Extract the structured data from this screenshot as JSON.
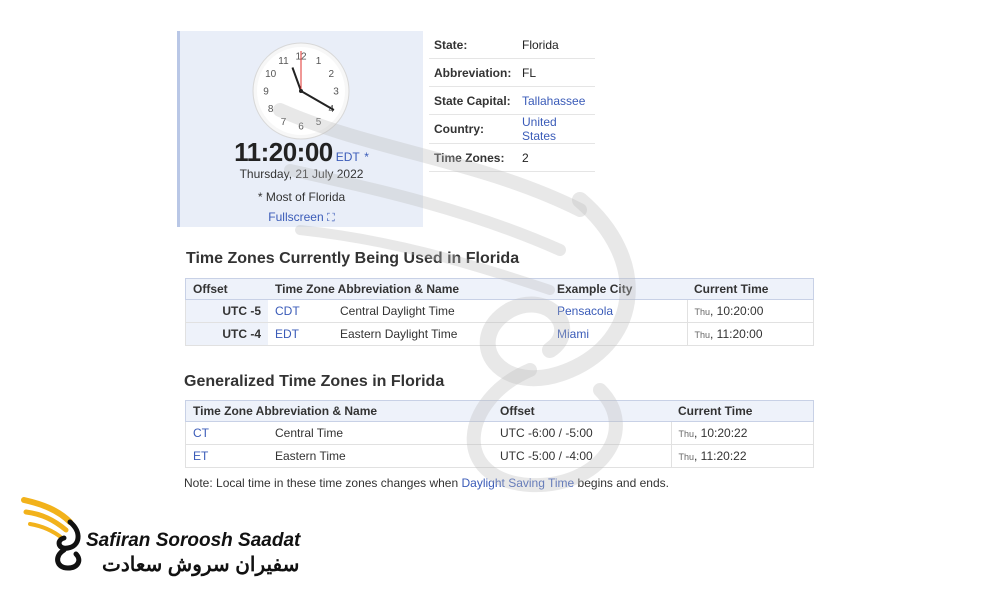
{
  "clock": {
    "numbers": [
      "12",
      "1",
      "2",
      "3",
      "4",
      "5",
      "6",
      "7",
      "8",
      "9",
      "10",
      "11"
    ],
    "time_hm": "11:20:00",
    "tz_abbr": "EDT",
    "star": "*",
    "date": "Thursday, 21 July 2022",
    "note": "* Most of Florida",
    "fullscreen_label": "Fullscreen",
    "fullscreen_icon": "expand-icon"
  },
  "info": {
    "rows": [
      {
        "key": "State:",
        "value": "Florida"
      },
      {
        "key": "Abbreviation:",
        "value": "FL"
      },
      {
        "key": "State Capital:",
        "value": "Tallahassee"
      },
      {
        "key": "Country:",
        "value": "United States"
      },
      {
        "key": "Time Zones:",
        "value": "2"
      }
    ]
  },
  "current_section": {
    "title": "Time Zones Currently Being Used in Florida",
    "headers": [
      "Offset",
      "Time Zone Abbreviation & Name",
      "Example City",
      "Current Time"
    ],
    "rows": [
      {
        "offset": "UTC -5",
        "abbr": "CDT",
        "name": "Central Daylight Time",
        "city": "Pensacola",
        "day": "Thu",
        "time": ", 10:20:00"
      },
      {
        "offset": "UTC -4",
        "abbr": "EDT",
        "name": "Eastern Daylight Time",
        "city": "Miami",
        "day": "Thu",
        "time": ", 11:20:00"
      }
    ]
  },
  "general_section": {
    "title": "Generalized Time Zones in Florida",
    "headers": [
      "Time Zone Abbreviation & Name",
      "Offset",
      "Current Time"
    ],
    "rows": [
      {
        "abbr": "CT",
        "name": "Central Time",
        "offset": "UTC -6:00 / -5:00",
        "day": "Thu",
        "time": ", 10:20:22"
      },
      {
        "abbr": "ET",
        "name": "Eastern Time",
        "offset": "UTC -5:00 / -4:00",
        "day": "Thu",
        "time": ", 11:20:22"
      }
    ]
  },
  "footnote": {
    "before": "Note: Local time in these time zones changes when ",
    "link": "Daylight Saving Time",
    "after": " begins and ends."
  },
  "logo": {
    "name_en": "Safiran Soroosh Saadat",
    "name_fa": "سفیران سروش سعادت",
    "accent": "#f2b21b"
  },
  "colors": {
    "link": "#3a5bb8",
    "second_hand": "#e0302e"
  }
}
